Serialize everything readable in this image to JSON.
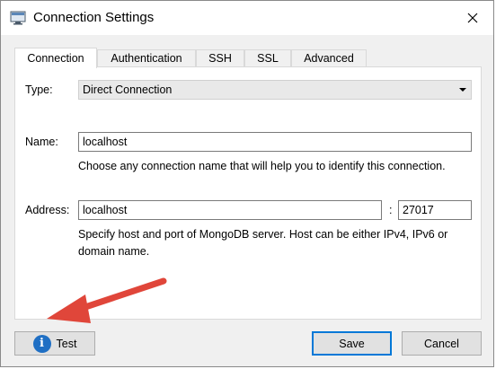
{
  "window": {
    "title": "Connection Settings"
  },
  "tabs": [
    {
      "label": "Connection",
      "active": true
    },
    {
      "label": "Authentication",
      "active": false
    },
    {
      "label": "SSH",
      "active": false
    },
    {
      "label": "SSL",
      "active": false
    },
    {
      "label": "Advanced",
      "active": false
    }
  ],
  "form": {
    "type_label": "Type:",
    "type_value": "Direct Connection",
    "name_label": "Name:",
    "name_value": "localhost",
    "name_hint": "Choose any connection name that will help you to identify this connection.",
    "address_label": "Address:",
    "address_value": "localhost",
    "port_separator": ":",
    "port_value": "27017",
    "address_hint_line1": "Specify host and port of MongoDB server. Host can be either IPv4, IPv6 or",
    "address_hint_line2": "domain name."
  },
  "buttons": {
    "test_label": "Test",
    "save_label": "Save",
    "cancel_label": "Cancel"
  },
  "colors": {
    "accent": "#0078d7",
    "info_icon": "#1f6fc4",
    "annotation_arrow": "#e0463a"
  },
  "icons": [
    "app-window-icon",
    "close-icon",
    "dropdown-arrow-icon",
    "info-icon",
    "annotation-arrow"
  ]
}
